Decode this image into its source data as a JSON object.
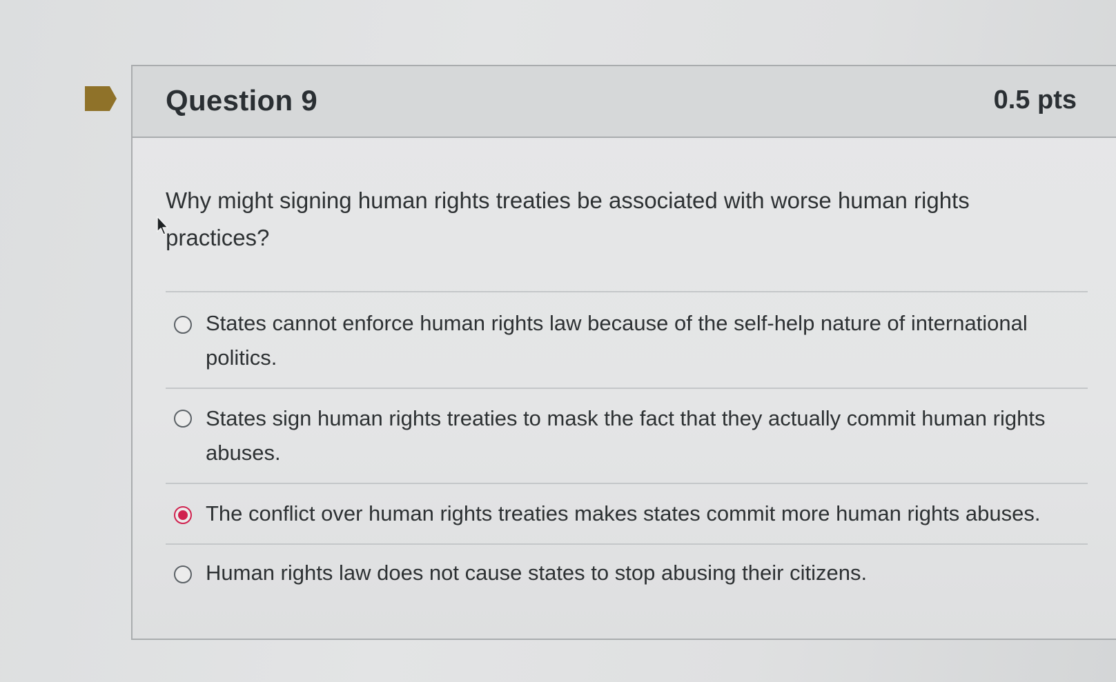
{
  "question": {
    "title": "Question 9",
    "points": "0.5 pts",
    "text": "Why might signing human rights treaties be associated with worse human rights practices?",
    "flag_color": "#8f7229"
  },
  "answers": [
    {
      "label": "States cannot enforce human rights law because of the self-help nature of international politics.",
      "selected": false
    },
    {
      "label": "States sign human rights treaties to mask the fact that they actually commit human rights abuses.",
      "selected": false
    },
    {
      "label": "The conflict over human rights treaties makes states commit more human rights abuses.",
      "selected": true
    },
    {
      "label": "Human rights law does not cause states to stop abusing their citizens.",
      "selected": false
    }
  ],
  "colors": {
    "selected_radio": "#d0224f",
    "text": "#2d3133"
  }
}
